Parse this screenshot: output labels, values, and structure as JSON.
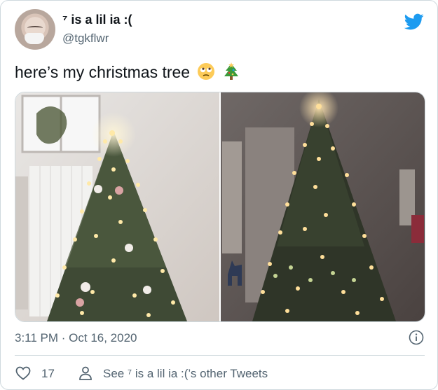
{
  "tweet": {
    "author_name": "⁷ is a lil ia :(",
    "author_handle": "@tgkflwr",
    "text": "here’s my christmas tree",
    "emojis": [
      "face-with-rolling-eyes",
      "christmas-tree"
    ],
    "media": [
      {
        "name": "photo-christmas-tree-lights-on"
      },
      {
        "name": "photo-christmas-tree-dark-room"
      }
    ],
    "timestamp": "3:11 PM · Oct 16, 2020",
    "like_count": "17",
    "see_more_label": "See ⁷ is a lil ia :(’s other Tweets"
  },
  "colors": {
    "twitter_blue": "#1d9bf0",
    "secondary_text": "#536471",
    "border": "#cfd9de"
  },
  "icons": [
    "twitter-bird-icon",
    "info-icon",
    "heart-icon",
    "user-icon"
  ]
}
